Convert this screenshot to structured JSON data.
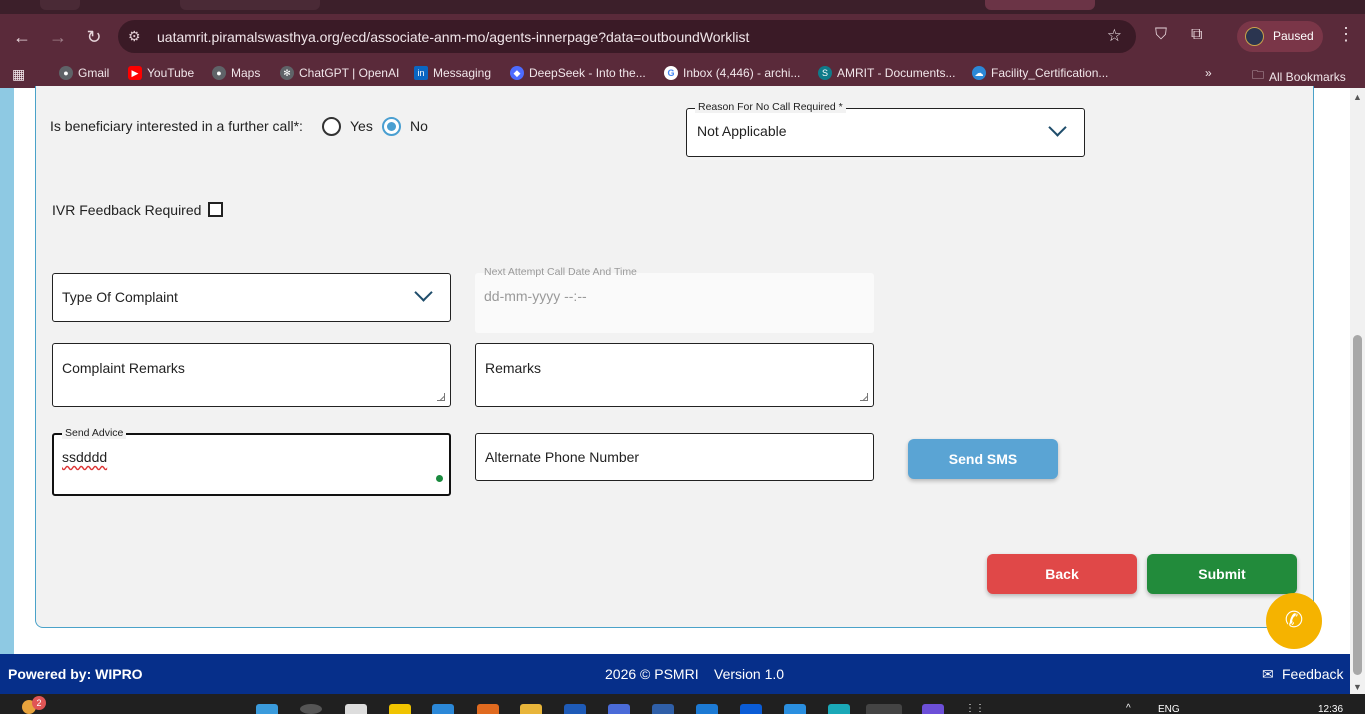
{
  "browser": {
    "url": "uatamrit.piramalswasthya.org/ecd/associate-anm-mo/agents-innerpage?data=outboundWorklist",
    "profile_status": "Paused",
    "bookmarks": [
      {
        "label": "Gmail",
        "color": "#5f6368"
      },
      {
        "label": "YouTube",
        "color": "#ff0000"
      },
      {
        "label": "Maps",
        "color": "#5f6368"
      },
      {
        "label": "ChatGPT | OpenAI",
        "color": "#5f6368"
      },
      {
        "label": "Messaging",
        "color": "#0a66c2"
      },
      {
        "label": "DeepSeek - Into the...",
        "color": "#4d6bfe"
      },
      {
        "label": "Inbox (4,446) - archi...",
        "color": "#4285f4"
      },
      {
        "label": "AMRIT - Documents...",
        "color": "#0f7b8a"
      },
      {
        "label": "Facility_Certification...",
        "color": "#2b88d8"
      }
    ],
    "all_bookmarks_label": "All Bookmarks"
  },
  "form": {
    "interested_question": "Is beneficiary interested in a further call*:",
    "option_yes": "Yes",
    "option_no": "No",
    "reason_label": "Reason For No Call Required *",
    "reason_value": "Not Applicable",
    "ivr_label": "IVR Feedback Required",
    "complaint_type_placeholder": "Type Of Complaint",
    "next_attempt_label": "Next Attempt Call Date And Time",
    "next_attempt_placeholder": "dd-mm-yyyy --:--",
    "complaint_remarks_placeholder": "Complaint Remarks",
    "remarks_placeholder": "Remarks",
    "send_advice_label": "Send Advice",
    "send_advice_value": "ssdddd",
    "alternate_phone_placeholder": "Alternate Phone Number",
    "send_sms_label": "Send SMS",
    "back_label": "Back",
    "submit_label": "Submit"
  },
  "colors": {
    "back": "#e04848",
    "submit": "#228b3b",
    "send_sms": "#5aa4d4",
    "footer": "#062f8a",
    "call_fab": "#f5b300"
  },
  "footer": {
    "powered_by": "Powered by: WIPRO",
    "copyright": "2026 © PSMRI",
    "version": "Version 1.0",
    "feedback": "Feedback"
  },
  "taskbar": {
    "notification_count": "2",
    "language": "ENG",
    "time": "12:36"
  }
}
